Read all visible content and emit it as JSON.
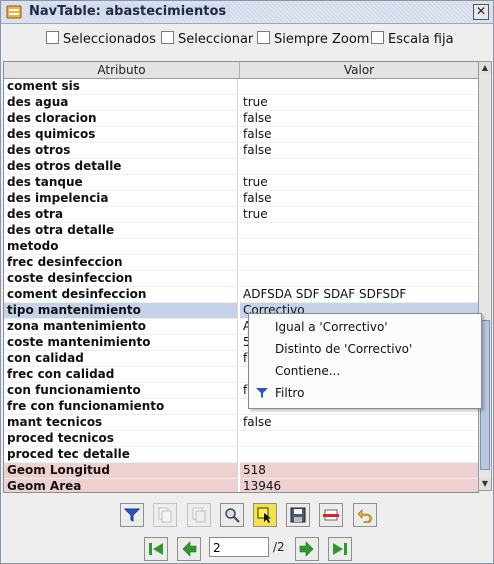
{
  "window": {
    "title": "NavTable: abastecimientos",
    "close_glyph": "✕"
  },
  "options": [
    {
      "label": "Seleccionados",
      "checked": false
    },
    {
      "label": "Seleccionar",
      "checked": false
    },
    {
      "label": "Siempre Zoom",
      "checked": false
    },
    {
      "label": "Escala fija",
      "checked": false
    }
  ],
  "table": {
    "headers": [
      "Atributo",
      "Valor"
    ],
    "rows": [
      {
        "attr": "coment sis",
        "value": ""
      },
      {
        "attr": "des agua",
        "value": "true"
      },
      {
        "attr": "des cloracion",
        "value": "false"
      },
      {
        "attr": "des quimicos",
        "value": "false"
      },
      {
        "attr": "des otros",
        "value": "false"
      },
      {
        "attr": "des otros detalle",
        "value": ""
      },
      {
        "attr": "des tanque",
        "value": "true"
      },
      {
        "attr": "des impelencia",
        "value": "false"
      },
      {
        "attr": "des otra",
        "value": "true"
      },
      {
        "attr": "des otra detalle",
        "value": ""
      },
      {
        "attr": "metodo",
        "value": ""
      },
      {
        "attr": "frec desinfeccion",
        "value": ""
      },
      {
        "attr": "coste desinfeccion",
        "value": ""
      },
      {
        "attr": "coment desinfeccion",
        "value": "ADFSDA SDF SDAF SDFSDF"
      },
      {
        "attr": "tipo mantenimiento",
        "value": "Correctivo"
      },
      {
        "attr": "zona mantenimiento",
        "value": "A"
      },
      {
        "attr": "coste mantenimiento",
        "value": "5"
      },
      {
        "attr": "con calidad",
        "value": "f"
      },
      {
        "attr": "frec con calidad",
        "value": ""
      },
      {
        "attr": "con funcionamiento",
        "value": "f"
      },
      {
        "attr": "fre con funcionamiento",
        "value": ""
      },
      {
        "attr": "mant tecnicos",
        "value": "false"
      },
      {
        "attr": "proced tecnicos",
        "value": ""
      },
      {
        "attr": "proced tec detalle",
        "value": ""
      },
      {
        "attr": "Geom Longitud",
        "value": "518"
      },
      {
        "attr": "Geom Area",
        "value": "13946"
      }
    ],
    "selected_row": 14,
    "geom_rows": [
      24,
      25
    ]
  },
  "context_menu": {
    "items": [
      {
        "label": "Igual a 'Correctivo'",
        "icon": ""
      },
      {
        "label": "Distinto de 'Correctivo'",
        "icon": ""
      },
      {
        "label": "Contiene...",
        "icon": ""
      },
      {
        "label": "Filtro",
        "icon": "filter-icon"
      }
    ]
  },
  "toolbar": {
    "buttons": [
      {
        "name": "filter-button",
        "icon": "filter-icon",
        "enabled": true
      },
      {
        "name": "copy-selected-button",
        "icon": "copy-icon",
        "enabled": false
      },
      {
        "name": "copy-previous-button",
        "icon": "copy-previous-icon",
        "enabled": false
      },
      {
        "name": "zoom-button",
        "icon": "magnifier-icon",
        "enabled": true
      },
      {
        "name": "select-button",
        "icon": "select-cursor-icon",
        "enabled": true
      },
      {
        "name": "save-button",
        "icon": "save-icon",
        "enabled": true
      },
      {
        "name": "delete-button",
        "icon": "delete-icon",
        "enabled": true
      },
      {
        "name": "undo-button",
        "icon": "undo-icon",
        "enabled": true
      }
    ]
  },
  "navigation": {
    "current": "2",
    "total_label": "/2",
    "accent": "#2e9a2e"
  }
}
